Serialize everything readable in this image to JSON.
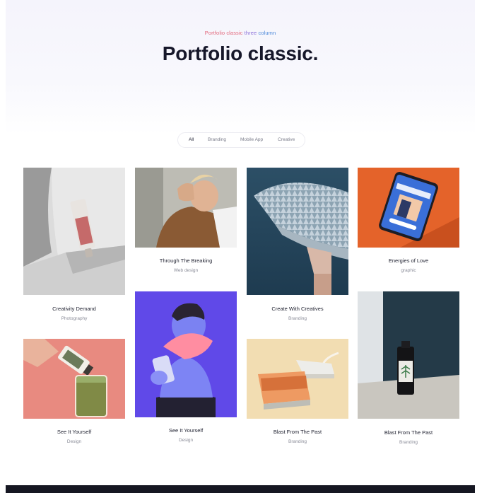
{
  "hero": {
    "eyebrow_part1": "Portfolio classic",
    "eyebrow_part2": " three",
    "eyebrow_part3": " column",
    "title": "Portfolio classic."
  },
  "filters": [
    "All",
    "Branding",
    "Mobile App",
    "Creative"
  ],
  "cards": [
    {
      "name": "Creativity Demand",
      "category": "Photography"
    },
    {
      "name": "Through The Breaking",
      "category": "Web design"
    },
    {
      "name": "Create With Creatives",
      "category": "Branding"
    },
    {
      "name": "Energies of Love",
      "category": "graphic"
    },
    {
      "name": "See It Yourself",
      "category": "Design"
    },
    {
      "name": "See It Yourself",
      "category": "Design"
    },
    {
      "name": "Blast From The Past",
      "category": "Branding"
    },
    {
      "name": "Blast From The Past",
      "category": "Branding"
    }
  ],
  "colors": {
    "eyebrow_pink": "#e2687b",
    "eyebrow_purple": "#8a6fd8",
    "eyebrow_blue": "#4a88d9",
    "heading": "#16172a",
    "footer": "#161722"
  }
}
